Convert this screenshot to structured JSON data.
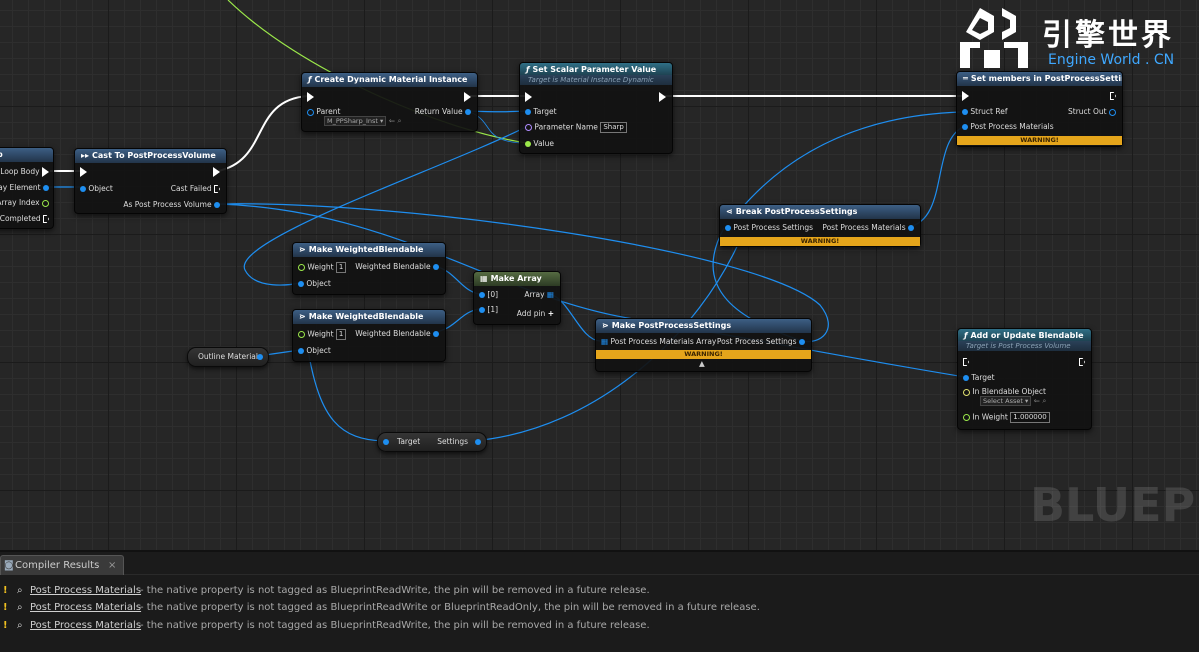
{
  "logo": {
    "cn_text": "引擎世界",
    "en_text": "Engine World . CN"
  },
  "watermark": "BLUEPR",
  "nodes": {
    "loop": {
      "loop_body": "Loop Body",
      "array_element": "ay Element",
      "array_index": "Array Index",
      "completed": "Completed",
      "title": "p"
    },
    "cast": {
      "title": "Cast To PostProcessVolume",
      "object": "Object",
      "cast_failed": "Cast Failed",
      "as_ppv": "As Post Process Volume"
    },
    "create_dmi": {
      "title": "Create Dynamic Material Instance",
      "parent": "Parent",
      "return_value": "Return Value",
      "parent_value": "M_PPSharp_Inst"
    },
    "set_scalar": {
      "title": "Set Scalar Parameter Value",
      "subtitle": "Target is Material Instance Dynamic",
      "target": "Target",
      "param_name": "Parameter Name",
      "param_value": "Sharp",
      "value": "Value"
    },
    "set_members": {
      "title": "Set members in PostProcessSettings",
      "struct_ref": "Struct Ref",
      "struct_out": "Struct Out",
      "ppm": "Post Process Materials",
      "warning": "WARNING!"
    },
    "break_pps": {
      "title": "Break PostProcessSettings",
      "in_pin": "Post Process Settings",
      "out_pin": "Post Process Materials",
      "warning": "WARNING!"
    },
    "mwb1": {
      "title": "Make WeightedBlendable",
      "weight": "Weight",
      "weight_value": "1",
      "out": "Weighted Blendable",
      "object": "Object"
    },
    "mwb2": {
      "title": "Make WeightedBlendable",
      "weight": "Weight",
      "weight_value": "1",
      "out": "Weighted Blendable",
      "object": "Object"
    },
    "make_array": {
      "title": "Make Array",
      "in0": "[0]",
      "in1": "[1]",
      "array": "Array",
      "add_pin": "Add pin"
    },
    "make_pps": {
      "title": "Make PostProcessSettings",
      "in_pin": "Post Process Materials Array",
      "out_pin": "Post Process Settings",
      "warning": "WARNING!"
    },
    "add_blend": {
      "title": "Add or Update Blendable",
      "subtitle": "Target is Post Process Volume",
      "target": "Target",
      "in_obj": "In Blendable Object",
      "select_asset": "Select Asset",
      "in_weight": "In Weight",
      "weight_value": "1.000000"
    }
  },
  "vars": {
    "outline": "Outline Material",
    "target": "Target",
    "settings": "Settings"
  },
  "panel": {
    "tab_label": "Compiler Results",
    "tab_close": "×",
    "messages": [
      {
        "link": "Post Process Materials",
        "text": "- the native property is not tagged as BlueprintReadWrite, the pin will be removed in a future release."
      },
      {
        "link": "Post Process Materials",
        "text": "- the native property is not tagged as BlueprintReadWrite or BlueprintReadOnly, the pin will be removed in a future release."
      },
      {
        "link": "Post Process Materials",
        "text": "- the native property is not tagged as BlueprintReadWrite, the pin will be removed in a future release."
      }
    ]
  },
  "colors": {
    "exec_wire": "#ffffff",
    "object_wire": "#1e8ef0",
    "float_wire": "#9be84a",
    "warning": "#e5a51b"
  }
}
